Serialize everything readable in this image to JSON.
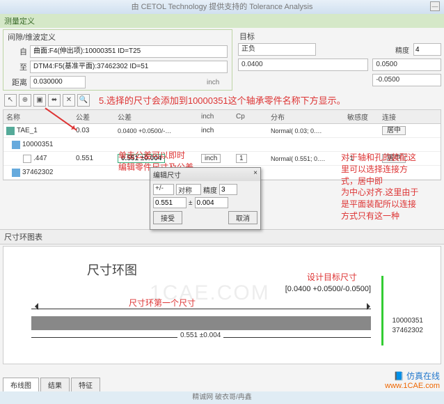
{
  "window": {
    "title": "由 CETOL Technology 提供支持的 Tolerance Analysis",
    "min": "—"
  },
  "panel": {
    "measure_title": "测量定义",
    "gap_title": "间隙/维波定义",
    "from_lbl": "自",
    "from_val": "曲面:F4(伸出项):10000351 ID=T25",
    "to_lbl": "至",
    "to_val": "DTM4:F5(基准平面):37462302 ID=51",
    "dist_lbl": "距离",
    "dist_val": "0.030000",
    "unit": "inch"
  },
  "target": {
    "title": "目标",
    "mode": "正负",
    "precision_lbl": "精度",
    "precision_val": "4",
    "nominal": "0.0400",
    "upper": "0.0500",
    "lower": "-0.0500"
  },
  "toolbar": {
    "b1": "↖",
    "b2": "⊕",
    "b3": "▣",
    "b4": "⬌",
    "b5": "✕",
    "b6": "🔍"
  },
  "annot": {
    "step5": "5.选择的尺寸会添加到10000351这个轴承零件名称下方显示。",
    "click_tol": "单击公差可以即时\n编辑零件尺寸及公差",
    "conn": "对于轴和孔的装配这\n里可以选择连接方\n式，居中即\n为中心对齐.这里由于\n是平面装配所以连接\n方式只有这一种"
  },
  "cols": {
    "name": "名称",
    "size": "公差",
    "tol": "公差",
    "unit": "inch",
    "cp": "Cp",
    "dist": "分布",
    "sens": "敏感度",
    "conn": "连接"
  },
  "rows": [
    {
      "name": "TAE_1",
      "size": "0.03",
      "tol": "0.0400 +0.0500/-…",
      "unit": "inch",
      "cp": "",
      "dist": "Normal( 0.03; 0.…",
      "sens": "",
      "conn": "居中"
    },
    {
      "name": "10000351",
      "size": "",
      "tol": "",
      "unit": "",
      "cp": "",
      "dist": "",
      "sens": "",
      "conn": ""
    },
    {
      "name": ".447",
      "size": "0.551",
      "tol": "0.551  ±0.004",
      "unit": "inch",
      "cp": "1",
      "dist": "Normal( 0.551; 0.…",
      "sens": "-1",
      "conn": "居中"
    },
    {
      "name": "37462302",
      "size": "",
      "tol": "",
      "unit": "",
      "cp": "",
      "dist": "",
      "sens": "",
      "conn": ""
    }
  ],
  "editdlg": {
    "title": "编辑尺寸",
    "close": "×",
    "mode": "+/-",
    "sym": "对称",
    "prec_lbl": "精度",
    "prec": "3",
    "nom": "0.551",
    "pm": "±",
    "tol": "0.004",
    "ok": "接受",
    "cancel": "取消"
  },
  "chart": {
    "section": "尺寸环图表",
    "title": "尺寸环图",
    "target_lbl": "设计目标尺寸",
    "target_val": "[0.0400 +0.0500/-0.0500]",
    "first_dim": "尺寸环第一个尺寸",
    "dim_label": "0.551 ±0.004",
    "part1": "10000351",
    "part2": "37462302"
  },
  "tabs": {
    "t1": "布线图",
    "t2": "结果",
    "t3": "特征"
  },
  "footer": "精诚网 破衣哥/冉鑫",
  "watermark": {
    "name": "仿真在线",
    "site": "www.1CAE.com"
  },
  "chart_data": {
    "type": "bar",
    "title": "尺寸环图",
    "series": [
      {
        "name": "10000351",
        "nominal": 0.551,
        "tol_plus": 0.004,
        "tol_minus": 0.004
      }
    ],
    "target": {
      "nominal": 0.04,
      "upper": 0.05,
      "lower": -0.05
    },
    "xlabel": "",
    "ylabel": ""
  }
}
